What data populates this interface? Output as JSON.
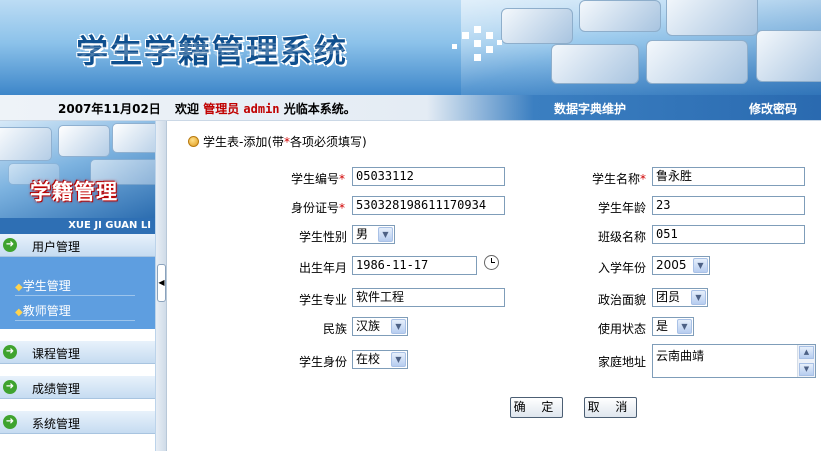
{
  "header": {
    "system_title": "学生学籍管理系统"
  },
  "topbar": {
    "date": "2007年11月02日",
    "welcome_prefix": "欢迎",
    "role": "管理员",
    "username": "admin",
    "welcome_suffix": "光临本系统。",
    "dict_link": "数据字典维护",
    "password_link": "修改密码"
  },
  "sidebar": {
    "banner_title": "学籍管理",
    "banner_subtitle": "XUE JI GUAN LI",
    "menus": [
      {
        "label": "用户管理",
        "icon": "arrow-right-circle-icon"
      },
      {
        "label": "课程管理",
        "icon": "arrow-right-circle-icon"
      },
      {
        "label": "成绩管理",
        "icon": "arrow-right-circle-icon"
      },
      {
        "label": "系统管理",
        "icon": "arrow-right-circle-icon"
      }
    ],
    "submenu": [
      {
        "label": "学生管理"
      },
      {
        "label": "教师管理"
      }
    ]
  },
  "form": {
    "title_prefix": "学生表-添加(带",
    "title_req": "*",
    "title_suffix": "各项必须填写)",
    "student_no": {
      "label": "学生编号",
      "required": "*",
      "value": "05033112"
    },
    "student_name": {
      "label": "学生名称",
      "required": "*",
      "value": "鲁永胜"
    },
    "id_card": {
      "label": "身份证号",
      "required": "*",
      "value": "530328198611170934"
    },
    "age": {
      "label": "学生年龄",
      "value": "23"
    },
    "gender": {
      "label": "学生性别",
      "value": "男"
    },
    "class_name": {
      "label": "班级名称",
      "value": "051"
    },
    "birth_date": {
      "label": "出生年月",
      "value": "1986-11-17"
    },
    "enroll_year": {
      "label": "入学年份",
      "value": "2005"
    },
    "major": {
      "label": "学生专业",
      "value": "软件工程"
    },
    "political": {
      "label": "政治面貌",
      "value": "团员"
    },
    "ethnicity": {
      "label": "民族",
      "value": "汉族"
    },
    "status": {
      "label": "使用状态",
      "value": "是"
    },
    "identity": {
      "label": "学生身份",
      "value": "在校"
    },
    "address": {
      "label": "家庭地址",
      "value": "云南曲靖"
    },
    "confirm": "确 定",
    "cancel": "取 消"
  }
}
